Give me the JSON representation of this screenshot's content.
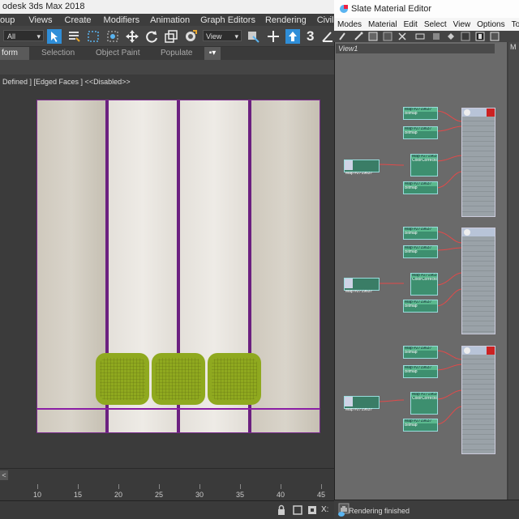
{
  "max": {
    "title": "odesk 3ds Max 2018",
    "menu": [
      "oup",
      "Views",
      "Create",
      "Modifiers",
      "Animation",
      "Graph Editors",
      "Rendering",
      "Civil View"
    ],
    "selection_filter": "All",
    "reference_coord": "View",
    "toolbar_badge": "3",
    "ribbon_tabs": [
      "form",
      "Selection",
      "Object Paint",
      "Populate"
    ],
    "viewport_label": "Defined ] [Edged Faces ]  <<Disabled>>",
    "ruler_labels": [
      "10",
      "15",
      "20",
      "25",
      "30",
      "35",
      "40",
      "45"
    ],
    "status_glyph": "X:"
  },
  "sme": {
    "title": "Slate Material Editor",
    "menu": [
      "Modes",
      "Material",
      "Edit",
      "Select",
      "View",
      "Options",
      "Tools"
    ],
    "view_tab": "View1",
    "status": "Rendering finished",
    "node_label": "Map #2719637",
    "node_sub": "Bitmap",
    "node_cc_label": "Map #2719635",
    "node_cc_sub": "ColorCorrection",
    "right_panel_letter": "M"
  },
  "colors": {
    "accent_blue": "#2f8ed8",
    "selection_purple": "#8b1ea5",
    "chair_green": "#8fa91f",
    "node_green": "#3d8f6f"
  }
}
